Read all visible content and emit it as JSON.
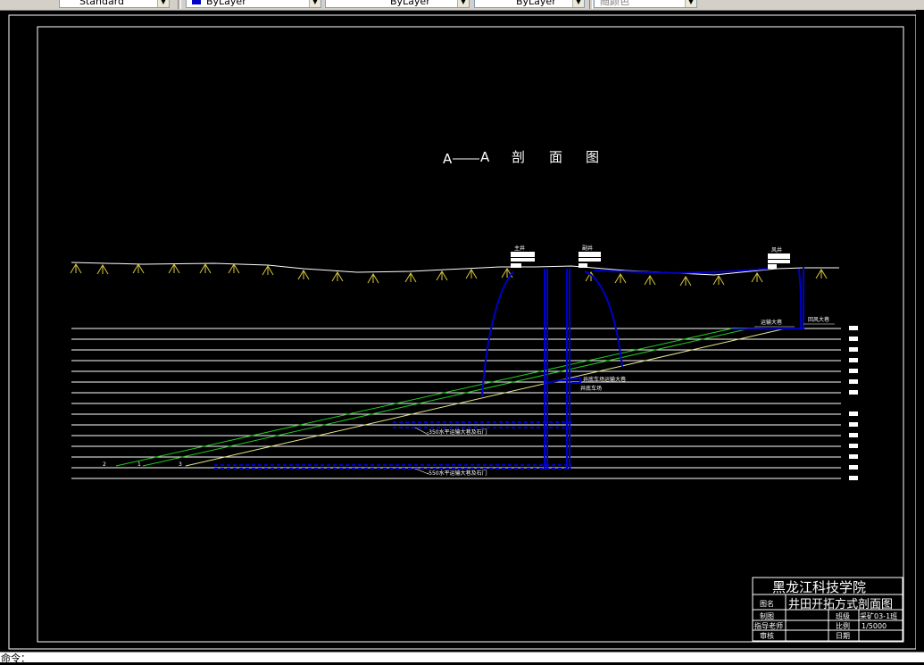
{
  "toolbar": {
    "textstyle_value": "Standard",
    "layer_color_value": "ByLayer",
    "linetype_value": "ByLayer",
    "lineweight_value": "ByLayer",
    "plotstyle_value": "随颜色"
  },
  "drawing": {
    "title_left": "A",
    "title_right": "A",
    "title_chars": [
      "剖",
      "面",
      "图"
    ],
    "buildings": [
      {
        "label": "主井"
      },
      {
        "label": "副井"
      },
      {
        "label": "风井"
      }
    ],
    "annotations": {
      "roadway_right_1": "运输大巷",
      "roadway_right_2": "回风大巷",
      "shaft_bottom_1": "井底车场运输大巷",
      "shaft_bottom_2": "井底车场",
      "level_1": "-350水平运输大巷及石门",
      "level_2": "-550水平运输大巷及石门"
    },
    "seam_labels": [
      "2",
      "1",
      "3"
    ],
    "colors": {
      "background": "#000000",
      "border": "#ffffff",
      "shaft": "#0000c8",
      "seam_green": "#22c822",
      "seam_yellow": "#e6e68c",
      "ground": "#ffffff",
      "vegetation": "#d7c83c"
    }
  },
  "title_block": {
    "school": "黑龙江科技学院",
    "name_label": "图名",
    "drawing_name": "井田开拓方式剖面图",
    "draw_label": "制图",
    "class_label": "班级",
    "class_value": "采矿03-1班",
    "advisor_label": "指导老师",
    "scale_label": "比例",
    "scale_value": "1/5000",
    "review_label": "审核",
    "date_label": "日期",
    "date_value": ""
  },
  "command_line": {
    "text": "命令："
  }
}
